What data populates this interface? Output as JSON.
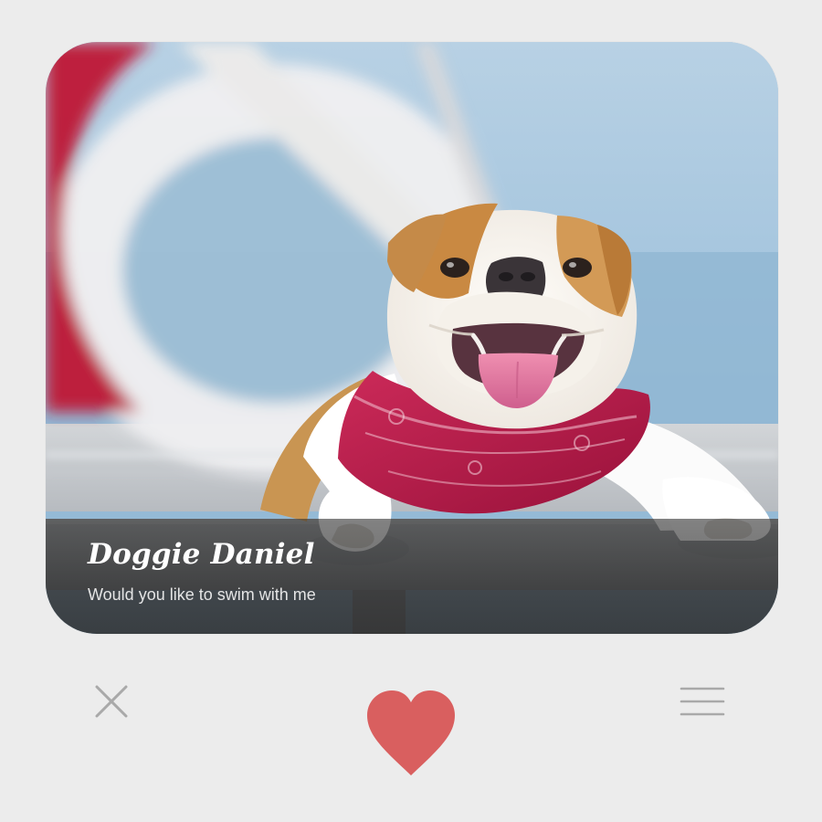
{
  "card": {
    "title": "Doggie  Daniel",
    "subtitle": "Would you like to swim with me"
  },
  "actions": {
    "dismiss_icon": "close-icon",
    "like_icon": "heart-icon",
    "menu_icon": "menu-icon"
  },
  "colors": {
    "background": "#ececec",
    "heart": "#d95f5f",
    "icon_gray": "#a9a9a9",
    "caption_overlay": "#2c2c2c",
    "bandana": "#b3143d"
  }
}
